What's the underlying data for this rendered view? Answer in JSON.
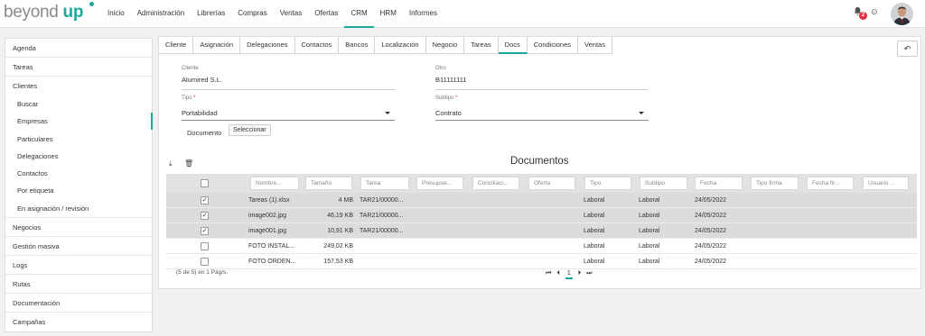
{
  "app": {
    "logo_text": "beyond",
    "logo_accent": "up",
    "accent_color": "#19a99b"
  },
  "nav": [
    "Inicio",
    "Administración",
    "Librerías",
    "Compras",
    "Ventas",
    "Ofertas",
    "CRM",
    "HRM",
    "Informes"
  ],
  "notifications": {
    "count": "2"
  },
  "sidebar": {
    "top": [
      "Agenda",
      "Tareas",
      "Clientes"
    ],
    "clientes_sub": [
      "Buscar",
      "Empresas",
      "Particulares",
      "Delegaciones",
      "Contactos",
      "Por etiqueta",
      "En asignación / revisión"
    ],
    "bottom": [
      "Negocios",
      "Gestión masiva",
      "Logs",
      "Rutas",
      "Documentación",
      "Campañas"
    ]
  },
  "tabs": [
    "Cliente",
    "Asignación",
    "Delegaciones",
    "Contactos",
    "Bancos",
    "Localización",
    "Negocio",
    "Tareas",
    "Docs",
    "Condiciones",
    "Ventas"
  ],
  "form": {
    "cliente_label": "Cliente",
    "cliente_value": "Alumired S.L.",
    "otro_label": "Otro",
    "otro_value": "B11111111",
    "tipo_label": "Tipo",
    "tipo_value": "Portabilidad",
    "subtipo_label": "Subtipo",
    "subtipo_value": "Contrato",
    "required_mark": "*",
    "documento_label": "Documento",
    "seleccionar_button": "Seleccionar"
  },
  "documents": {
    "title": "Documentos",
    "filters": [
      "Nombre...",
      "Tamaño",
      "Tarea",
      "Presupue...",
      "Conciliaci...",
      "Oferta",
      "Tipo",
      "Subtipo",
      "Fecha",
      "Tipo firma",
      "Fecha fir...",
      "Usuario ..."
    ],
    "rows": [
      {
        "checked": true,
        "name": "Tareas (1).xlsx",
        "size": "4 MB",
        "task": "TAR21/00000...",
        "tipo": "Laboral",
        "subtipo": "Laboral",
        "fecha": "24/05/2022"
      },
      {
        "checked": true,
        "name": "image002.jpg",
        "size": "46,19 KB",
        "task": "TAR21/00000...",
        "tipo": "Laboral",
        "subtipo": "Laboral",
        "fecha": "24/05/2022"
      },
      {
        "checked": true,
        "name": "image001.jpg",
        "size": "10,91 KB",
        "task": "TAR21/00000...",
        "tipo": "Laboral",
        "subtipo": "Laboral",
        "fecha": "24/05/2022"
      },
      {
        "checked": false,
        "name": "FOTO INSTAL...",
        "size": "249,02 KB",
        "task": "",
        "tipo": "Laboral",
        "subtipo": "Laboral",
        "fecha": "24/05/2022"
      },
      {
        "checked": false,
        "name": "FOTO ORDEN...",
        "size": "157,53 KB",
        "task": "",
        "tipo": "Laboral",
        "subtipo": "Laboral",
        "fecha": "24/05/2022"
      }
    ],
    "footer": "(5 de 5) en 1 Pág/s.",
    "page": "1"
  }
}
